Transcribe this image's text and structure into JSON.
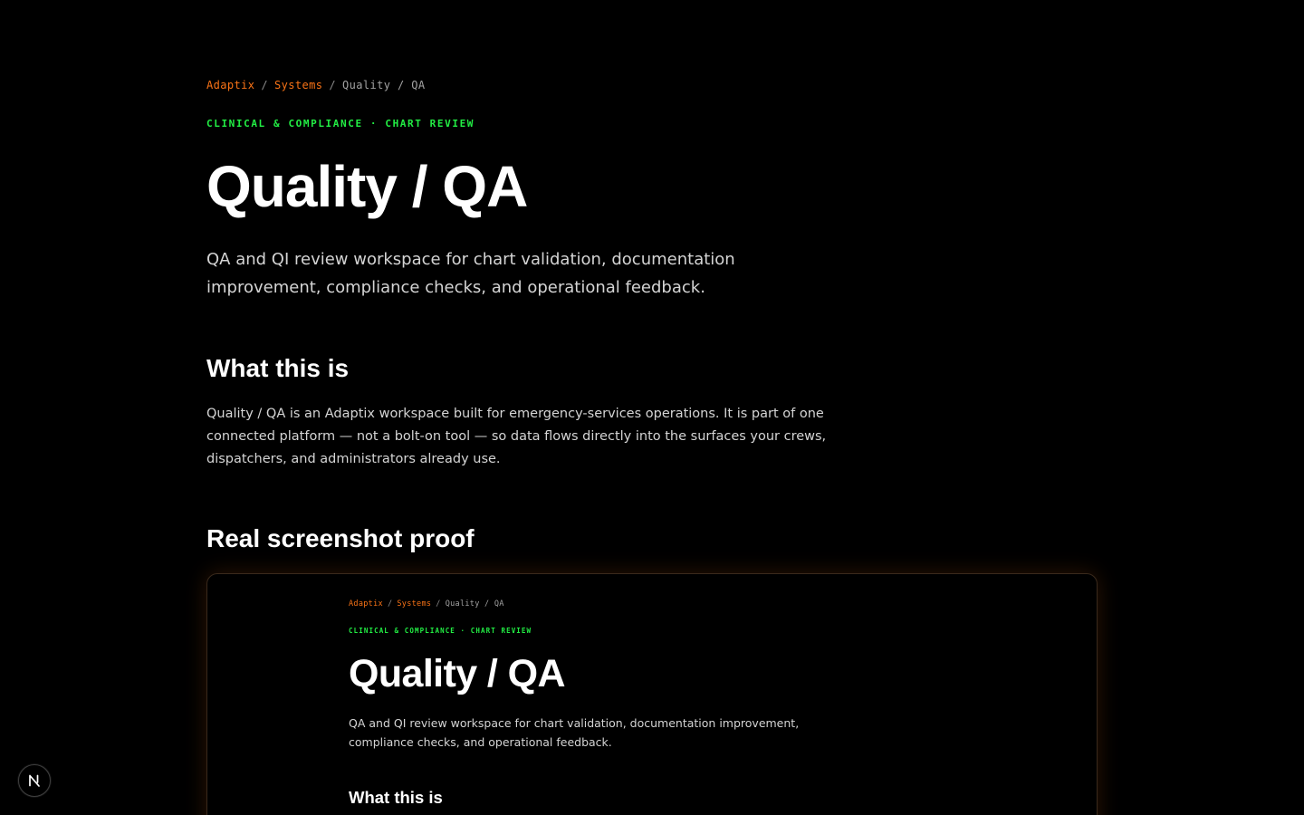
{
  "breadcrumb": {
    "items": [
      "Adaptix",
      "Systems",
      "Quality / QA"
    ],
    "separator": "/"
  },
  "eyebrow": "CLINICAL & COMPLIANCE · CHART REVIEW",
  "page_title": "Quality / QA",
  "lede": "QA and QI review workspace for chart validation, documentation improvement, compliance checks, and operational feedback.",
  "sections": {
    "what_heading": "What this is",
    "what_body": "Quality / QA is an Adaptix workspace built for emergency-services operations. It is part of one connected platform — not a bolt-on tool — so data flows directly into the surfaces your crews, dispatchers, and administrators already use.",
    "proof_heading": "Real screenshot proof"
  },
  "dev_badge": {
    "icon": "nextjs-icon",
    "letter": "N"
  },
  "colors": {
    "background": "#000000",
    "accent": "#f97316",
    "eyebrow": "#22ee44",
    "text": "#ffffff",
    "muted": "#d4d4d4"
  }
}
